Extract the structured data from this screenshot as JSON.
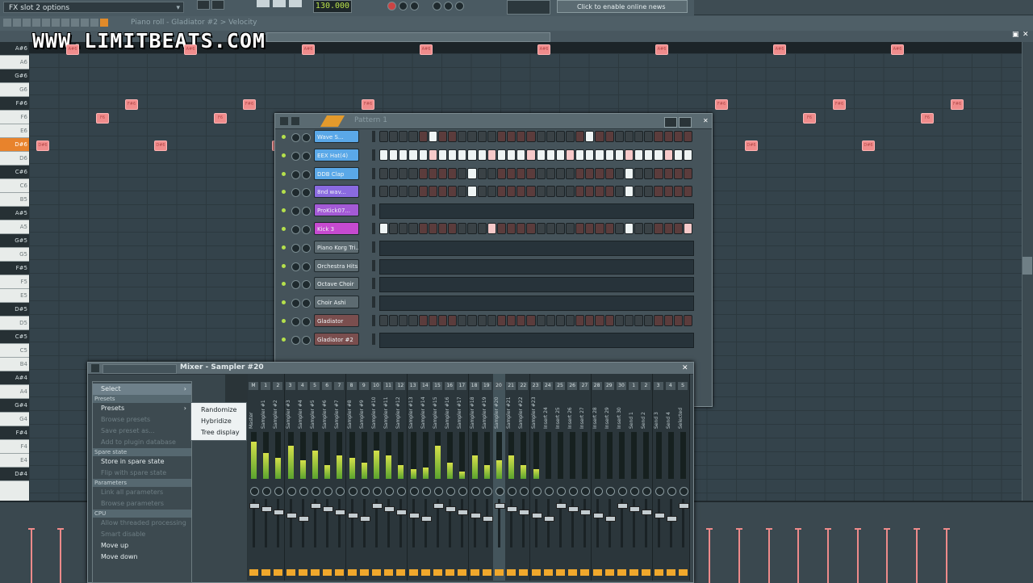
{
  "toolbar": {
    "hint_field": "FX slot 2 options",
    "tempo": "130.000",
    "hint_bar": "Click to enable online news"
  },
  "piano_roll": {
    "title": "Piano roll - Gladiator #2 > Velocity",
    "keys": [
      "A#6",
      "A6",
      "G#6",
      "G6",
      "F#6",
      "F6",
      "E6",
      "D#6",
      "D6",
      "C#6",
      "C6",
      "B5",
      "A#5",
      "A5",
      "G#5",
      "G5",
      "F#5",
      "F5",
      "E5",
      "D#5",
      "D5",
      "C#5",
      "C5",
      "B4",
      "A#4",
      "A4",
      "G#4",
      "G4",
      "F#4",
      "F4",
      "E4",
      "D#4"
    ],
    "highlighted_key": "D#6",
    "note_label_a": "A#6",
    "note_label_f": "F6",
    "note_label_fs": "F#6",
    "note_label_ds": "D#6"
  },
  "watermark": "WWW.LIMITBEATS.COM",
  "channel_rack": {
    "title": "Pattern 1",
    "channels": [
      {
        "label": "Wave S...",
        "color": "#5aa8e8",
        "type": "steps"
      },
      {
        "label": "EEX Hat(4)",
        "color": "#5aa8e8",
        "type": "steps"
      },
      {
        "label": "DDB Clap",
        "color": "#5aa8e8",
        "type": "steps"
      },
      {
        "label": "8nd wav...",
        "color": "#8a6ae0",
        "type": "steps"
      },
      {
        "label": "ProKick07...",
        "color": "#a45ad6",
        "type": "seq"
      },
      {
        "label": "Kick 3",
        "color": "#c64ad0",
        "type": "steps"
      },
      {
        "label": "Piano Korg Tri...",
        "color": "#5d6b71",
        "type": "seq"
      },
      {
        "label": "Orchestra Hits",
        "color": "#5d6b71",
        "type": "seq"
      },
      {
        "label": "Octave Choir",
        "color": "#5d6b71",
        "type": "seq"
      },
      {
        "label": "Choir Ashi",
        "color": "#5d6b71",
        "type": "seq"
      },
      {
        "label": "Gladiator",
        "color": "#7a4e4e",
        "type": "steps"
      },
      {
        "label": "Gladiator #2",
        "color": "#7a4e4e",
        "type": "seq"
      }
    ]
  },
  "mixer": {
    "title": "Mixer - Sampler #20",
    "strips": [
      {
        "num": "M",
        "name": "Master"
      },
      {
        "num": "1",
        "name": "Sampler #1"
      },
      {
        "num": "2",
        "name": "Sampler #2"
      },
      {
        "num": "3",
        "name": "Sampler #3"
      },
      {
        "num": "4",
        "name": "Sampler #4"
      },
      {
        "num": "5",
        "name": "Sampler #5"
      },
      {
        "num": "6",
        "name": "Sampler #6"
      },
      {
        "num": "7",
        "name": "Sampler #7"
      },
      {
        "num": "8",
        "name": "Sampler #8"
      },
      {
        "num": "9",
        "name": "Sampler #9"
      },
      {
        "num": "10",
        "name": "Sampler #10"
      },
      {
        "num": "11",
        "name": "Sampler #11"
      },
      {
        "num": "12",
        "name": "Sampler #12"
      },
      {
        "num": "13",
        "name": "Sampler #13"
      },
      {
        "num": "14",
        "name": "Sampler #14"
      },
      {
        "num": "15",
        "name": "Sampler #15"
      },
      {
        "num": "16",
        "name": "Sampler #16"
      },
      {
        "num": "17",
        "name": "Sampler #17"
      },
      {
        "num": "18",
        "name": "Sampler #18"
      },
      {
        "num": "19",
        "name": "Sampler #19"
      },
      {
        "num": "20",
        "name": "Sampler #20"
      },
      {
        "num": "21",
        "name": "Sampler #21"
      },
      {
        "num": "22",
        "name": "Sampler #22"
      },
      {
        "num": "23",
        "name": "Sampler #23"
      },
      {
        "num": "24",
        "name": "Insert 24"
      },
      {
        "num": "25",
        "name": "Insert 25"
      },
      {
        "num": "26",
        "name": "Insert 26"
      },
      {
        "num": "27",
        "name": "Insert 27"
      },
      {
        "num": "28",
        "name": "Insert 28"
      },
      {
        "num": "29",
        "name": "Insert 29"
      },
      {
        "num": "30",
        "name": "Insert 30"
      },
      {
        "num": "1",
        "name": "Send 1"
      },
      {
        "num": "2",
        "name": "Send 2"
      },
      {
        "num": "3",
        "name": "Send 3"
      },
      {
        "num": "4",
        "name": "Send 4"
      },
      {
        "num": "S",
        "name": "Selected"
      }
    ],
    "levels": [
      0.8,
      0.55,
      0.45,
      0.7,
      0.4,
      0.6,
      0.3,
      0.5,
      0.45,
      0.35,
      0.6,
      0.5,
      0.3,
      0.2,
      0.25,
      0.7,
      0.35,
      0.15,
      0.5,
      0.3,
      0.4,
      0.5,
      0.3,
      0.2,
      0.0,
      0.0,
      0.0,
      0.0,
      0.0,
      0.0,
      0.0,
      0.0,
      0.0,
      0.0,
      0.0,
      0.0
    ]
  },
  "context_menu": {
    "items": [
      {
        "label": "Select",
        "kind": "sel",
        "arrow": true
      },
      {
        "label": "Presets",
        "kind": "hdr"
      },
      {
        "label": "Presets",
        "kind": "item",
        "arrow": true
      },
      {
        "label": "Browse presets",
        "kind": "dis"
      },
      {
        "label": "Save preset as...",
        "kind": "dis"
      },
      {
        "label": "Add to plugin database",
        "kind": "dis"
      },
      {
        "label": "Spare state",
        "kind": "hdr"
      },
      {
        "label": "Store in spare state",
        "kind": "item"
      },
      {
        "label": "Flip with spare state",
        "kind": "dis"
      },
      {
        "label": "Parameters",
        "kind": "hdr"
      },
      {
        "label": "Link all parameters",
        "kind": "dis"
      },
      {
        "label": "Browse parameters",
        "kind": "dis"
      },
      {
        "label": "CPU",
        "kind": "hdr"
      },
      {
        "label": "Allow threaded processing",
        "kind": "dis"
      },
      {
        "label": "Smart disable",
        "kind": "dis"
      },
      {
        "label": "Move up",
        "kind": "item"
      },
      {
        "label": "Move down",
        "kind": "item"
      }
    ],
    "submenu": [
      "Randomize",
      "Hybridize",
      "Tree display"
    ]
  }
}
